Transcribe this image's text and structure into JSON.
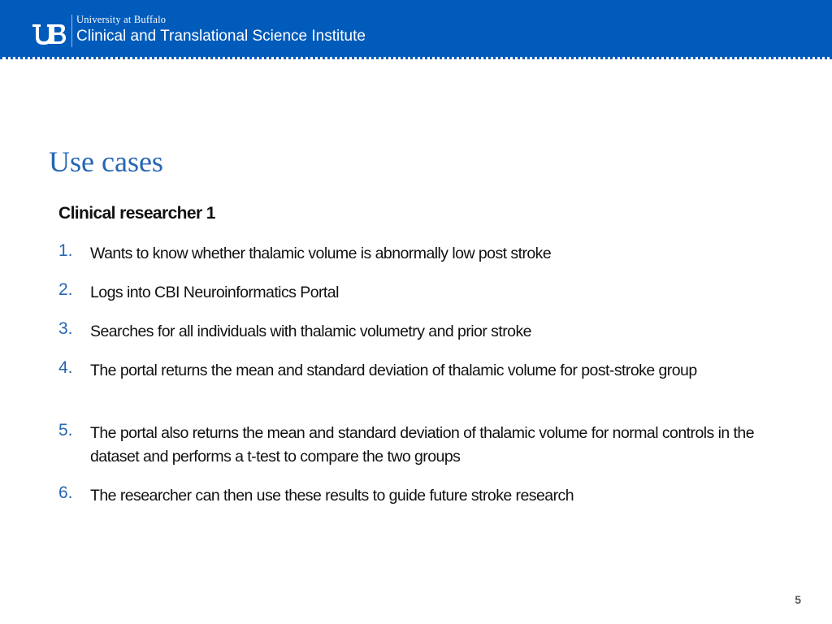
{
  "header": {
    "university": "University at Buffalo",
    "institute": "Clinical and Translational Science Institute",
    "brand_color": "#005bbb",
    "logo_icon": "ub-logo-icon"
  },
  "slide": {
    "title": "Use cases",
    "subtitle": "Clinical researcher 1",
    "accent_color": "#2666b3",
    "steps": [
      {
        "number": "1.",
        "text": "Wants to know whether thalamic volume is abnormally low post stroke"
      },
      {
        "number": "2.",
        "text": "Logs into CBI Neuroinformatics Portal"
      },
      {
        "number": "3.",
        "text": "Searches for all individuals with thalamic volumetry and prior stroke"
      },
      {
        "number": "4.",
        "text": "The portal returns the mean and standard deviation of thalamic volume for post-stroke group"
      },
      {
        "number": "5.",
        "text": "The portal also returns the mean and standard deviation of thalamic volume for normal controls in the dataset and performs a t-test to compare the two groups"
      },
      {
        "number": "6.",
        "text": "The researcher can then use these results to guide future stroke research"
      }
    ],
    "page_number": "5"
  }
}
